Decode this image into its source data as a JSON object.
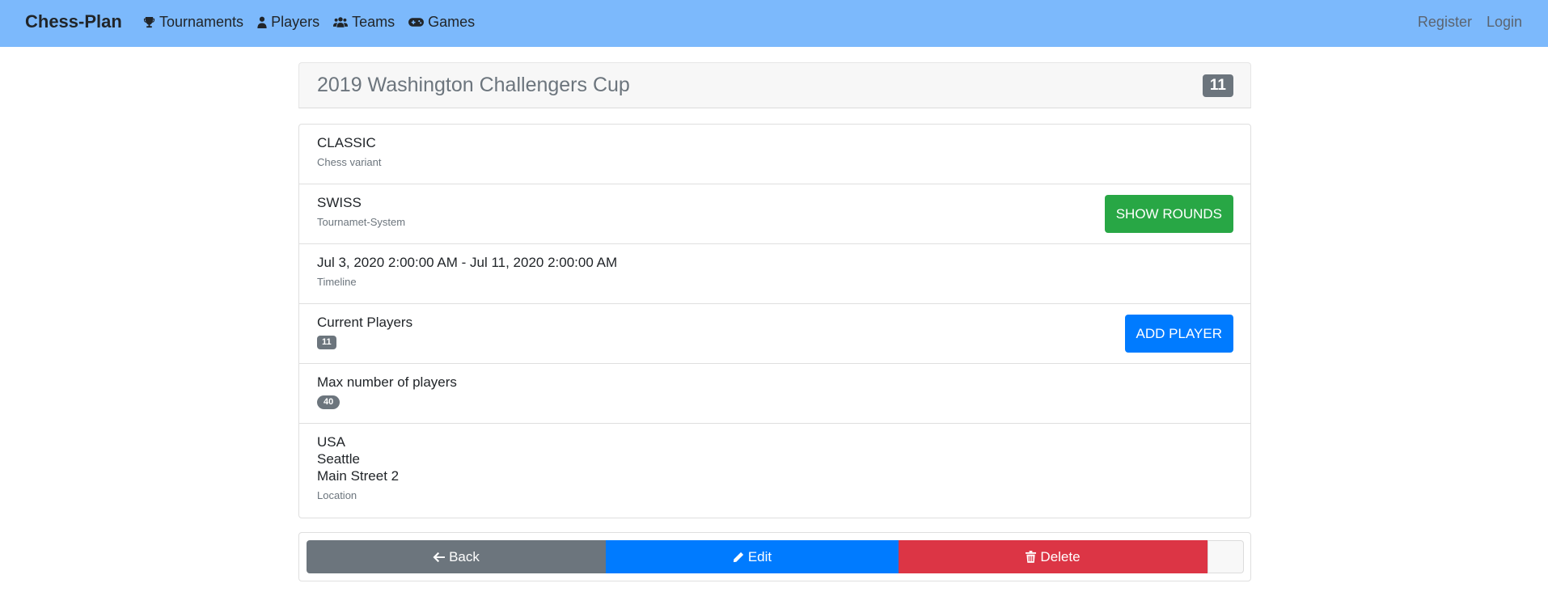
{
  "navbar": {
    "brand": "Chess-Plan",
    "links": [
      {
        "label": "Tournaments",
        "icon": "trophy-icon"
      },
      {
        "label": "Players",
        "icon": "user-icon"
      },
      {
        "label": "Teams",
        "icon": "users-icon"
      },
      {
        "label": "Games",
        "icon": "gamepad-icon"
      }
    ],
    "register": "Register",
    "login": "Login"
  },
  "tournament": {
    "title": "2019 Washington Challengers Cup",
    "player_count_badge": "11"
  },
  "details": {
    "variant": {
      "value": "CLASSIC",
      "label": "Chess variant"
    },
    "system": {
      "value": "SWISS",
      "label": "Tournamet-System",
      "button": "SHOW ROUNDS"
    },
    "timeline": {
      "value": "Jul 3, 2020 2:00:00 AM - Jul 11, 2020 2:00:00 AM",
      "label": "Timeline"
    },
    "current_players": {
      "label": "Current Players",
      "count": "11",
      "button": "ADD PLAYER"
    },
    "max_players": {
      "label": "Max number of players",
      "count": "40"
    },
    "location": {
      "country": "USA",
      "city": "Seattle",
      "street": "Main Street 2",
      "label": "Location"
    }
  },
  "actions": {
    "back": "Back",
    "edit": "Edit",
    "delete": "Delete"
  },
  "colors": {
    "navbar": "#7cb9fc",
    "success": "#28a745",
    "primary": "#007bff",
    "danger": "#dc3545",
    "secondary": "#6c757d"
  }
}
